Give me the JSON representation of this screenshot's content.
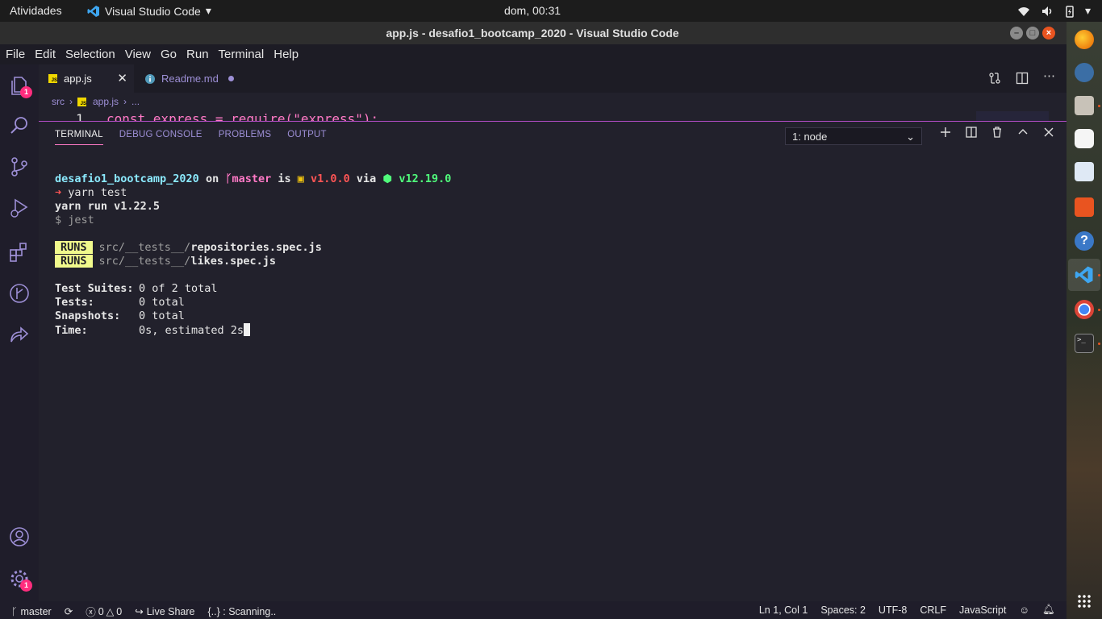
{
  "topbar": {
    "activities": "Atividades",
    "app_name": "Visual Studio Code",
    "clock": "dom, 00:31"
  },
  "window": {
    "title": "app.js - desafio1_bootcamp_2020 - Visual Studio Code"
  },
  "menu": [
    "File",
    "Edit",
    "Selection",
    "View",
    "Go",
    "Run",
    "Terminal",
    "Help"
  ],
  "activitybar": {
    "explorer_badge": "1",
    "settings_badge": "1"
  },
  "tabs": [
    {
      "label": "app.js",
      "active": true
    },
    {
      "label": "Readme.md",
      "active": false
    }
  ],
  "breadcrumb": {
    "folder": "src",
    "file": "app.js",
    "more": "..."
  },
  "code": {
    "line_number": "1",
    "line_text": "const express = require(\"express\");"
  },
  "panel": {
    "tabs": [
      "TERMINAL",
      "DEBUG CONSOLE",
      "PROBLEMS",
      "OUTPUT"
    ],
    "terminal_select": "1: node"
  },
  "terminal": {
    "prompt_dir": "desafio1_bootcamp_2020",
    "on": " on ",
    "branch": "master",
    "is": " is ",
    "pkg_version": "v1.0.0",
    "via": " via ",
    "node_version": "v12.19.0",
    "cmd": "yarn test",
    "yarn_line": "yarn run v1.22.5",
    "jest_line": "$ jest",
    "runs_label": "RUNS",
    "run1_path": "src/__tests__/",
    "run1_file": "repositories.spec.js",
    "run2_path": "src/__tests__/",
    "run2_file": "likes.spec.js",
    "suites_label": "Test Suites:",
    "suites_value": "0 of 2 total",
    "tests_label": "Tests:",
    "tests_value": "0 total",
    "snapshots_label": "Snapshots:",
    "snapshots_value": "0 total",
    "time_label": "Time:",
    "time_value": "0s, estimated 2s"
  },
  "statusbar": {
    "branch": "master",
    "errors": "0",
    "warnings": "0",
    "live_share": "Live Share",
    "scanning": "{..} : Scanning..",
    "position": "Ln 1, Col 1",
    "spaces": "Spaces: 2",
    "encoding": "UTF-8",
    "eol": "CRLF",
    "language": "JavaScript"
  },
  "colors": {
    "accent_pink": "#ff79c6",
    "purple_text": "#9d8fd6",
    "badge": "#ff2d7e"
  }
}
